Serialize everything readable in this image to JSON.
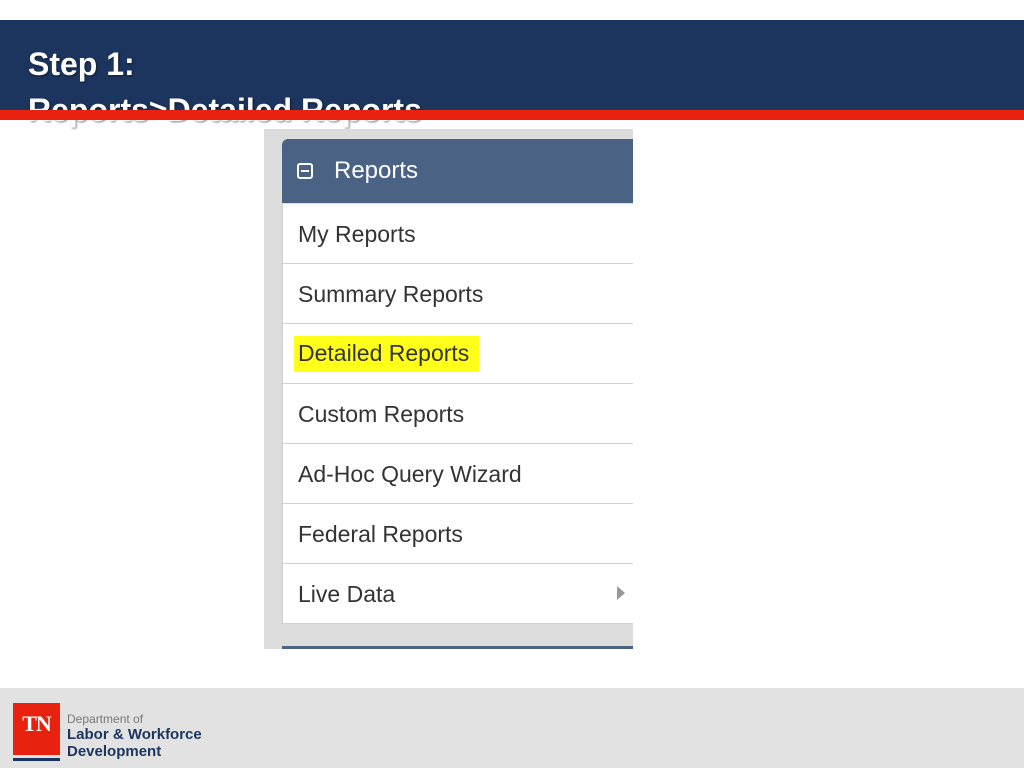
{
  "slide": {
    "title_line1": "Step 1:",
    "title_line2": "Reports>Detailed Reports"
  },
  "menu": {
    "header_label": "Reports",
    "header_icon": "collapse-box-icon",
    "items": [
      {
        "label": "My Reports"
      },
      {
        "label": "Summary Reports"
      },
      {
        "label": "Detailed Reports",
        "highlighted": true
      },
      {
        "label": "Custom Reports"
      },
      {
        "label": "Ad-Hoc Query Wizard"
      },
      {
        "label": "Federal Reports"
      },
      {
        "label": "Live Data",
        "has_submenu": true
      }
    ]
  },
  "footer": {
    "logo_text": "TN",
    "dept_line1": "Department of",
    "dept_line2": "Labor & Workforce",
    "dept_line3": "Development"
  },
  "colors": {
    "title_bar": "#1c355e",
    "accent_stripe": "#e8220f",
    "menu_header": "#4a6284",
    "highlight": "#ffff1a"
  }
}
